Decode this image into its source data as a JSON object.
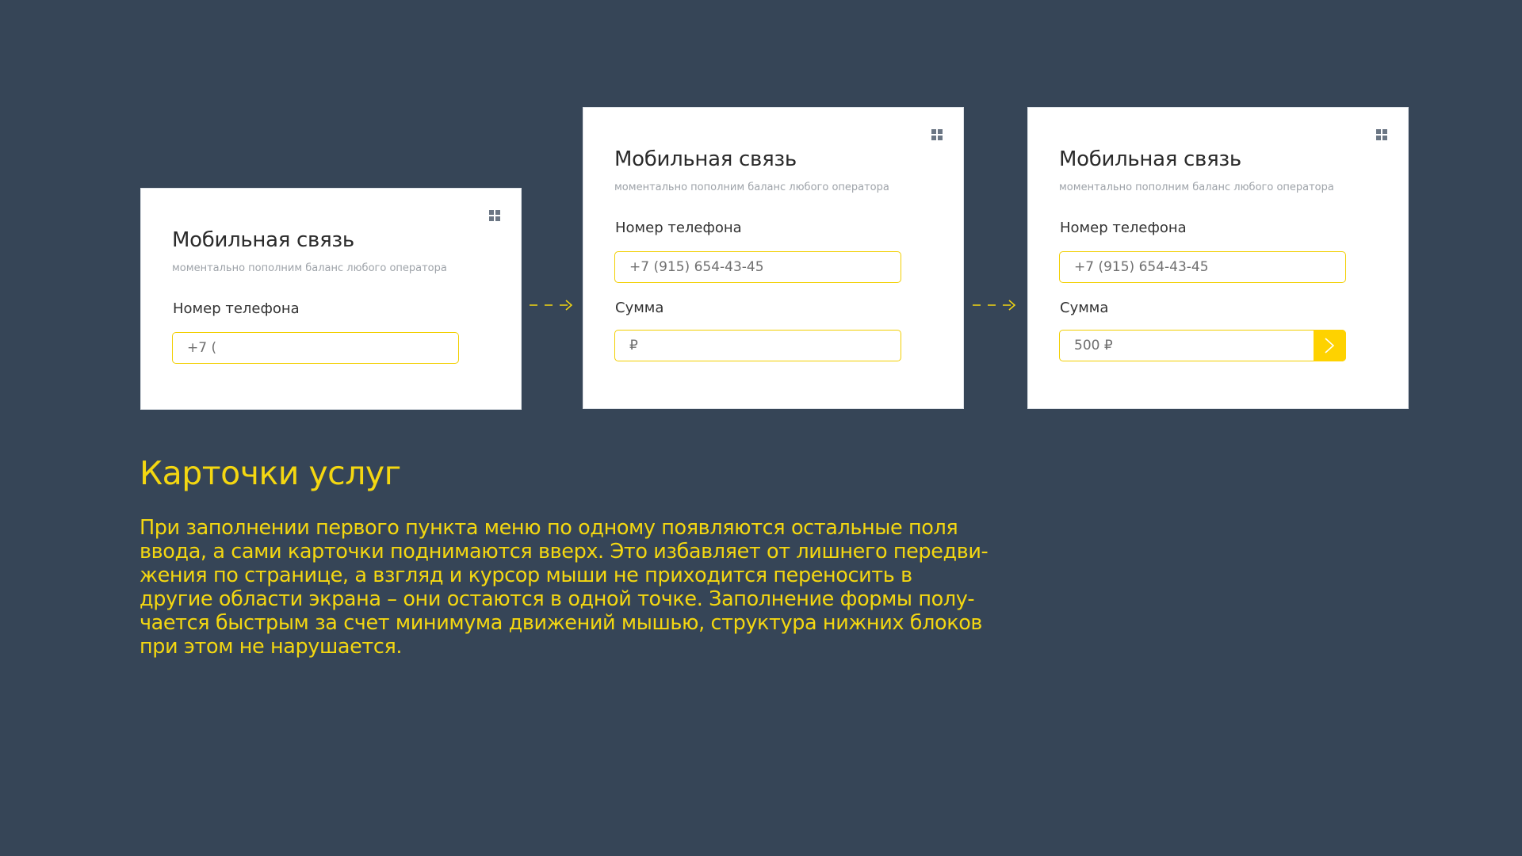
{
  "colors": {
    "background": "#364557",
    "card": "#ffffff",
    "accent": "#fed200",
    "field_border": "#f2cf00",
    "heading_text": "#f4d711"
  },
  "cards": [
    {
      "title": "Мобильная связь",
      "subtitle": "моментально пополним баланс любого оператора",
      "menu_icon": "grid-icon",
      "phone_label": "Номер телефона",
      "phone_value": "+7 ("
    },
    {
      "title": "Мобильная связь",
      "subtitle": "моментально пополним баланс любого оператора",
      "menu_icon": "grid-icon",
      "phone_label": "Номер телефона",
      "phone_value": "+7 (915) 654-43-45",
      "sum_label": "Сумма",
      "sum_value": "₽"
    },
    {
      "title": "Мобильная связь",
      "subtitle": "моментально пополним баланс любого оператора",
      "menu_icon": "grid-icon",
      "phone_label": "Номер телефона",
      "phone_value": "+7 (915) 654-43-45",
      "sum_label": "Сумма",
      "sum_value": "500 ₽",
      "submit_icon": "chevron-right-icon"
    }
  ],
  "flow_arrow_icon": "dashed-arrow-right-icon",
  "section": {
    "title": "Карточки услуг",
    "description_lines": [
      "При заполнении первого пункта меню по одному появляются остальные поля",
      "ввода, а сами карточки поднимаются вверх. Это избавляет от лишнего передви-",
      "жения по странице, а взгляд и курсор мыши не приходится переносить в",
      "другие области экрана – они остаются в одной точке. Заполнение формы полу-",
      "чается быстрым за счет минимума движений мышью, структура нижних блоков",
      "при этом не нарушается."
    ]
  }
}
